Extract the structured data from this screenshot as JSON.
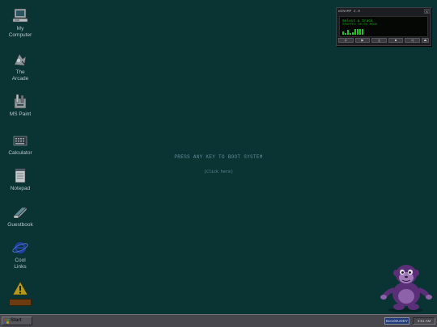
{
  "desktop": {
    "icons": [
      {
        "label": "My\nComputer",
        "icon": "computer-icon"
      },
      {
        "label": "The\nArcade",
        "icon": "arcade-icon"
      },
      {
        "label": "MS Paint",
        "icon": "paint-icon"
      },
      {
        "label": "Calculator",
        "icon": "calculator-icon"
      },
      {
        "label": "Notepad",
        "icon": "notepad-icon"
      },
      {
        "label": "Guestbook",
        "icon": "guestbook-icon"
      },
      {
        "label": "Cool\nLinks",
        "icon": "internet-explorer-icon"
      },
      {
        "label": "",
        "icon": "warning-icon"
      }
    ],
    "boot_message": "PRESS ANY KEY TO BOOT SYSTEM",
    "boot_hint": "(Click here)"
  },
  "player": {
    "title": "WINAMP 2.0",
    "close": "X",
    "track": "Select a track",
    "status": "STOPPED  00:00  MONO",
    "buttons": [
      "|<",
      "▶",
      "||",
      "■",
      ">|",
      "⏏"
    ],
    "visualizer_levels": [
      0.5,
      0.3,
      0.7,
      0.2,
      0.4,
      0.9,
      0.9,
      0.9,
      0.9
    ]
  },
  "taskbar": {
    "start_label": "Start",
    "task_label": "BonziBUDDY",
    "clock": "3:51 AM"
  },
  "colors": {
    "desktop_bg": "#0a3434",
    "lcd_green": "#20c020",
    "mascot_purple": "#6b3b8a"
  }
}
